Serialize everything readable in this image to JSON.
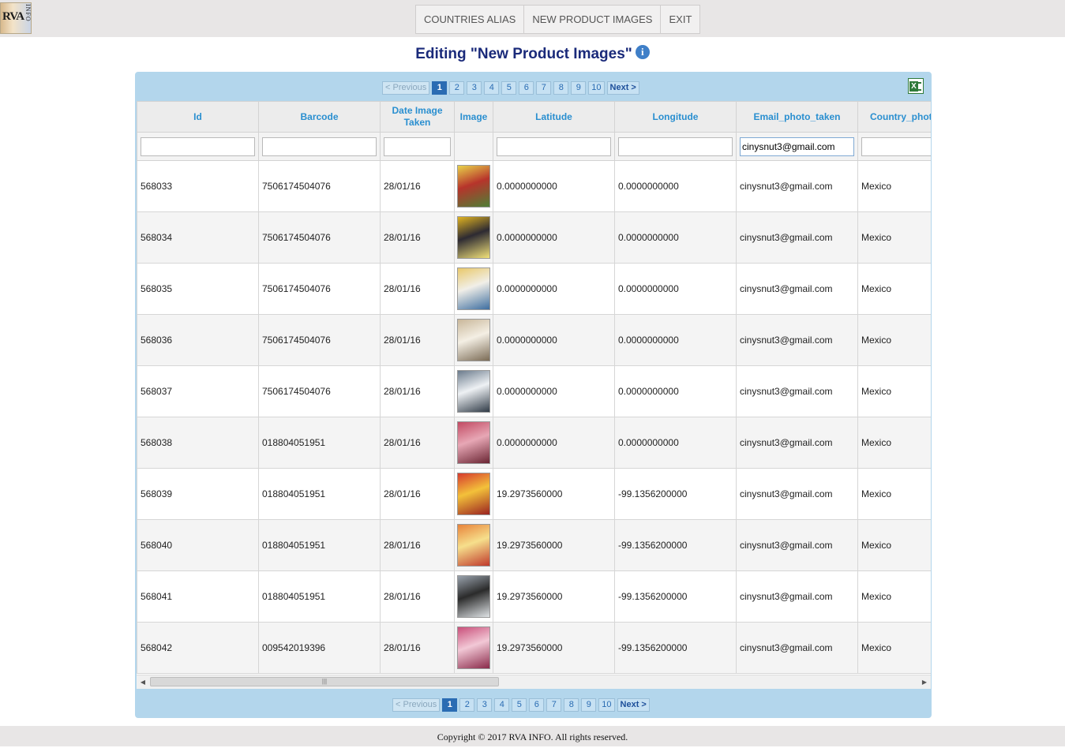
{
  "nav": {
    "logo_text": "RVA",
    "logo_sub": "INFO",
    "items": [
      "COUNTRIES ALIAS",
      "NEW PRODUCT IMAGES",
      "EXIT"
    ]
  },
  "page": {
    "title": "Editing \"New Product Images\""
  },
  "pager": {
    "previous": "< Previous",
    "next": "Next >",
    "pages": [
      "1",
      "2",
      "3",
      "4",
      "5",
      "6",
      "7",
      "8",
      "9",
      "10"
    ],
    "current": "1"
  },
  "table": {
    "columns": [
      "Id",
      "Barcode",
      "Date Image Taken",
      "Image",
      "Latitude",
      "Longitude",
      "Email_photo_taken",
      "Country_photo_taken"
    ],
    "filters": {
      "email": "cinysnut3@gmail.com"
    },
    "rows": [
      {
        "id": "568033",
        "barcode": "7506174504076",
        "date": "28/01/16",
        "lat": "0.0000000000",
        "lng": "0.0000000000",
        "email": "cinysnut3@gmail.com",
        "country": "Mexico",
        "thumb": [
          "#e8d24a",
          "#b7342b",
          "#4e7f36"
        ]
      },
      {
        "id": "568034",
        "barcode": "7506174504076",
        "date": "28/01/16",
        "lat": "0.0000000000",
        "lng": "0.0000000000",
        "email": "cinysnut3@gmail.com",
        "country": "Mexico",
        "thumb": [
          "#e0b321",
          "#2d2a32",
          "#f2e27a"
        ]
      },
      {
        "id": "568035",
        "barcode": "7506174504076",
        "date": "28/01/16",
        "lat": "0.0000000000",
        "lng": "0.0000000000",
        "email": "cinysnut3@gmail.com",
        "country": "Mexico",
        "thumb": [
          "#e9c86a",
          "#f1efe8",
          "#3d6ea0"
        ]
      },
      {
        "id": "568036",
        "barcode": "7506174504076",
        "date": "28/01/16",
        "lat": "0.0000000000",
        "lng": "0.0000000000",
        "email": "cinysnut3@gmail.com",
        "country": "Mexico",
        "thumb": [
          "#c9b79a",
          "#f4efe4",
          "#7b6b55"
        ]
      },
      {
        "id": "568037",
        "barcode": "7506174504076",
        "date": "28/01/16",
        "lat": "0.0000000000",
        "lng": "0.0000000000",
        "email": "cinysnut3@gmail.com",
        "country": "Mexico",
        "thumb": [
          "#6b7b8c",
          "#eef1f4",
          "#2f3a46"
        ]
      },
      {
        "id": "568038",
        "barcode": "018804051951",
        "date": "28/01/16",
        "lat": "0.0000000000",
        "lng": "0.0000000000",
        "email": "cinysnut3@gmail.com",
        "country": "Mexico",
        "thumb": [
          "#c24a63",
          "#e7a7b5",
          "#6a2533"
        ]
      },
      {
        "id": "568039",
        "barcode": "018804051951",
        "date": "28/01/16",
        "lat": "19.2973560000",
        "lng": "-99.1356200000",
        "email": "cinysnut3@gmail.com",
        "country": "Mexico",
        "thumb": [
          "#d63a2e",
          "#f3c13a",
          "#9a2220"
        ]
      },
      {
        "id": "568040",
        "barcode": "018804051951",
        "date": "28/01/16",
        "lat": "19.2973560000",
        "lng": "-99.1356200000",
        "email": "cinysnut3@gmail.com",
        "country": "Mexico",
        "thumb": [
          "#e8833a",
          "#f6df8c",
          "#c0392b"
        ]
      },
      {
        "id": "568041",
        "barcode": "018804051951",
        "date": "28/01/16",
        "lat": "19.2973560000",
        "lng": "-99.1356200000",
        "email": "cinysnut3@gmail.com",
        "country": "Mexico",
        "thumb": [
          "#9aa3ad",
          "#2b2b2b",
          "#dfe3e6"
        ]
      },
      {
        "id": "568042",
        "barcode": "009542019396",
        "date": "28/01/16",
        "lat": "19.2973560000",
        "lng": "-99.1356200000",
        "email": "cinysnut3@gmail.com",
        "country": "Mexico",
        "thumb": [
          "#c94f7a",
          "#f2c8d6",
          "#8a2a4a"
        ]
      }
    ]
  },
  "footer": {
    "text": "Copyright © 2017 RVA INFO. All rights reserved."
  }
}
